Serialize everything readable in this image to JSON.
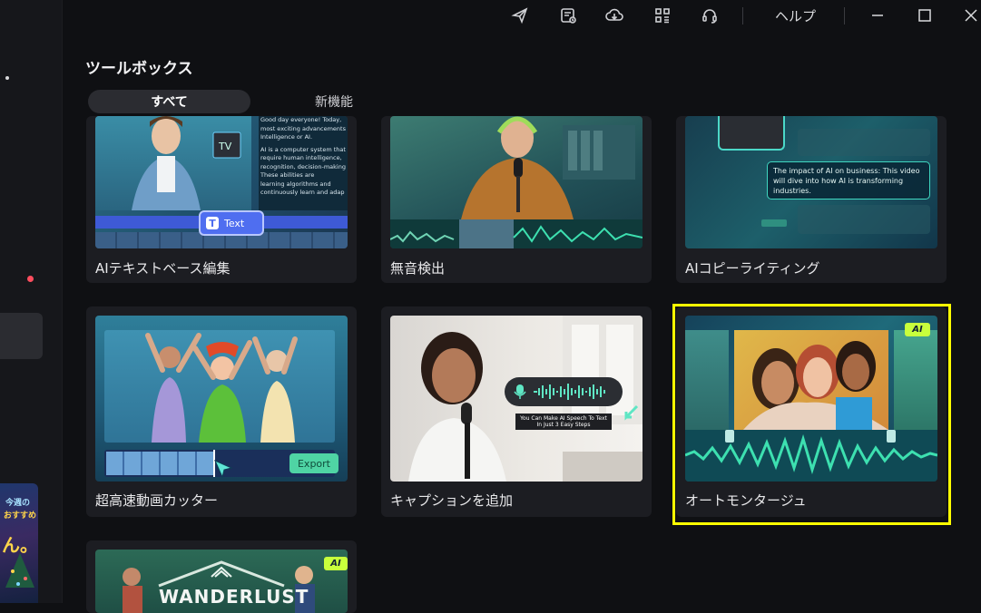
{
  "sidebar": {
    "banner_text_1": "今週の",
    "banner_text_2": "おすすめ",
    "banner_text_3": "ん。"
  },
  "titlebar": {
    "icons": [
      "send-icon",
      "task-list-icon",
      "cloud-download-icon",
      "grid-apps-icon",
      "headset-icon"
    ],
    "help_label": "ヘルプ"
  },
  "page": {
    "title": "ツールボックス"
  },
  "tabs": [
    {
      "label": "すべて",
      "active": true
    },
    {
      "label": "新機能",
      "active": false
    }
  ],
  "cards": [
    {
      "label": "AIテキストベース編集",
      "thumb_text_button": "Text",
      "thumb_lines": [
        "Good day everyone! Today,",
        "most exciting advancements",
        "Intelligence or AI.",
        "AI is a computer system that",
        "require human intelligence,",
        "recognition, decision-making",
        "These abilities are",
        "learning algorithms and",
        "continuously learn and adap"
      ]
    },
    {
      "label": "無音検出"
    },
    {
      "label": "AIコピーライティング",
      "thumb_caption": "The impact of AI on business: This video will dive into how AI is transforming industries."
    },
    {
      "label": "超高速動画カッター",
      "thumb_button": "Export"
    },
    {
      "label": "キャプションを追加",
      "thumb_caption": "You Can Make AI Speech To Text In Just 3 Easy Steps"
    },
    {
      "label": "オートモンタージュ",
      "badge": "AI",
      "selected": true
    },
    {
      "label": "",
      "badge": "AI",
      "thumb_title": "WANDERLUST"
    }
  ],
  "colors": {
    "accent": "#ffff00",
    "ai_badge": "#c8ff3c",
    "waveform": "#3de0b0"
  }
}
